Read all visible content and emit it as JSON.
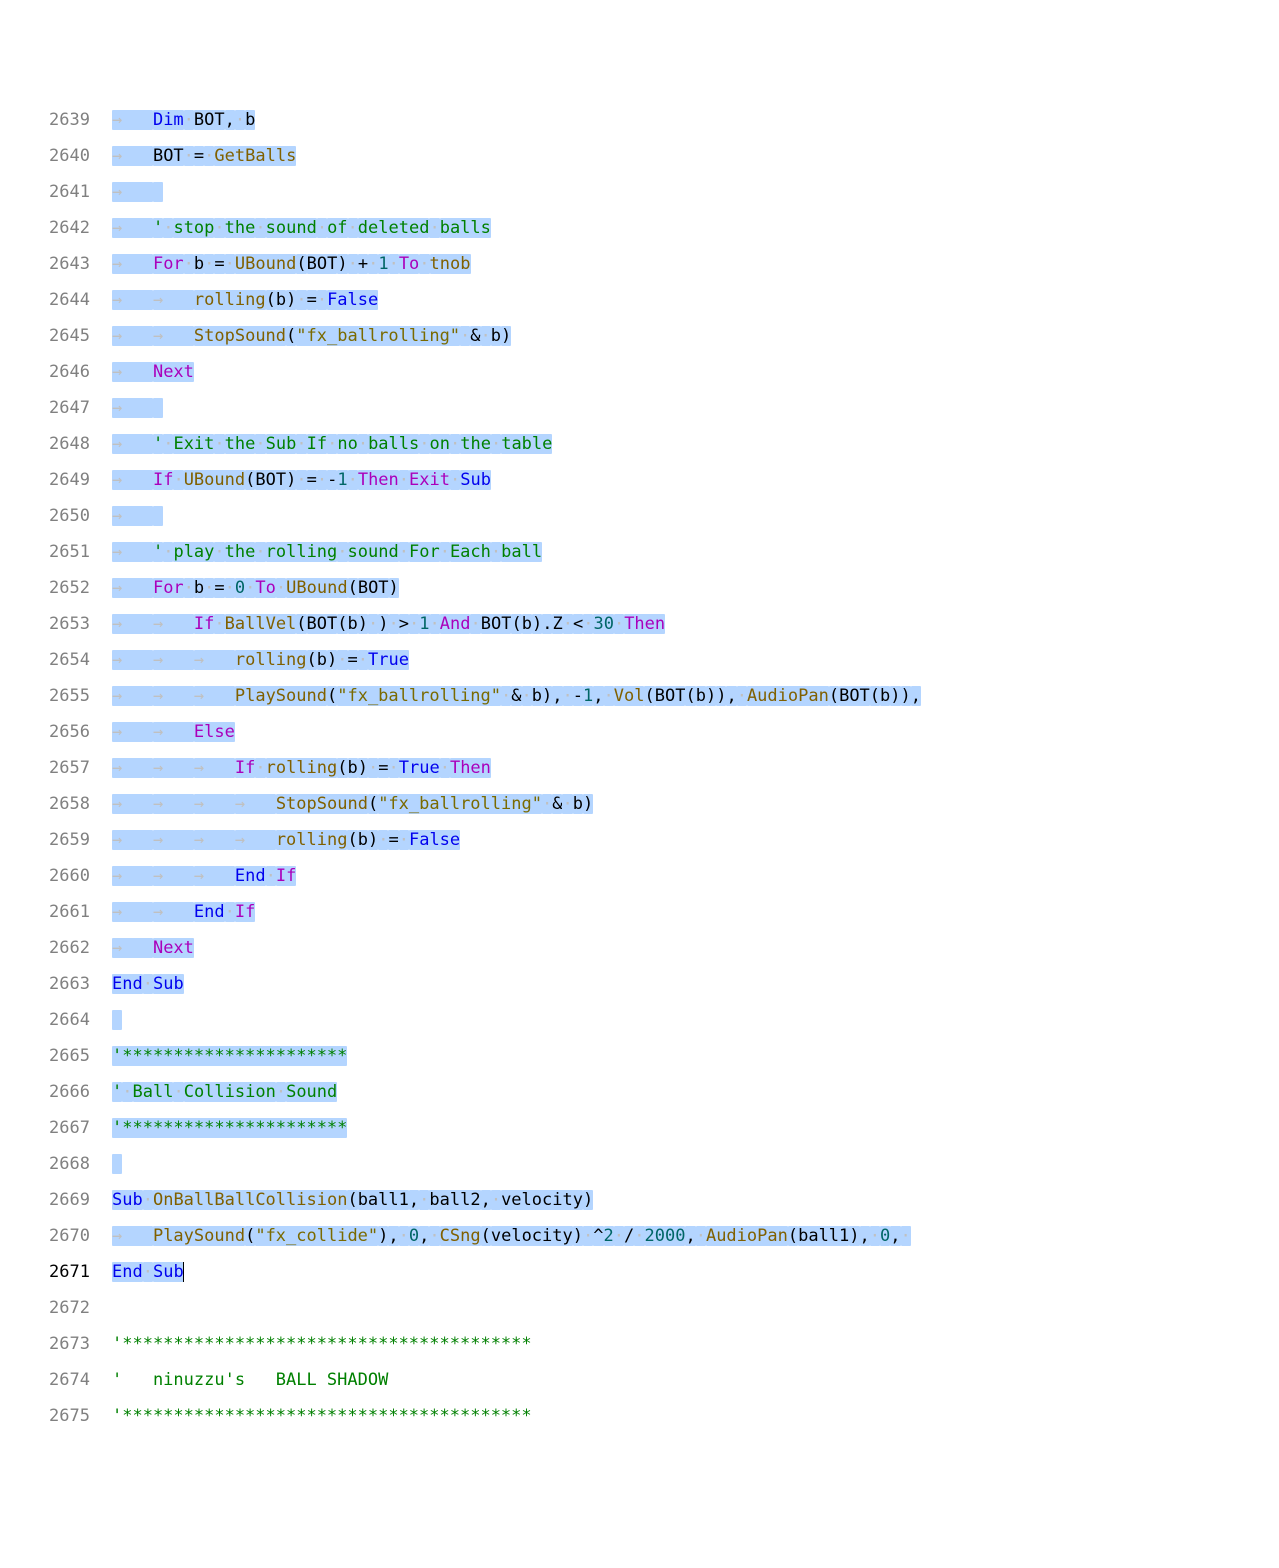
{
  "startLine": 2639,
  "currentLine": 2671,
  "selection": {
    "fromLine": 2639,
    "toLine": 2671
  },
  "ws": {
    "tab": "→",
    "dot": "·"
  },
  "lines": [
    {
      "n": 2639,
      "indent": 1,
      "sel": true,
      "tokens": [
        [
          "kw2",
          "Dim"
        ],
        [
          "ws",
          "·"
        ],
        [
          "pn",
          "BOT"
        ],
        [
          "pn",
          ","
        ],
        [
          "ws",
          "·"
        ],
        [
          "pn",
          "b"
        ]
      ]
    },
    {
      "n": 2640,
      "indent": 1,
      "sel": true,
      "tokens": [
        [
          "pn",
          "BOT"
        ],
        [
          "ws",
          "·"
        ],
        [
          "op",
          "="
        ],
        [
          "ws",
          "·"
        ],
        [
          "id",
          "GetBalls"
        ]
      ]
    },
    {
      "n": 2641,
      "indent": 1,
      "sel": true,
      "tokens": []
    },
    {
      "n": 2642,
      "indent": 1,
      "sel": true,
      "tokens": [
        [
          "com",
          "'"
        ],
        [
          "ws",
          "·"
        ],
        [
          "com",
          "stop"
        ],
        [
          "ws",
          "·"
        ],
        [
          "com",
          "the"
        ],
        [
          "ws",
          "·"
        ],
        [
          "com",
          "sound"
        ],
        [
          "ws",
          "·"
        ],
        [
          "com",
          "of"
        ],
        [
          "ws",
          "·"
        ],
        [
          "com",
          "deleted"
        ],
        [
          "ws",
          "·"
        ],
        [
          "com",
          "balls"
        ]
      ]
    },
    {
      "n": 2643,
      "indent": 1,
      "sel": true,
      "tokens": [
        [
          "kw",
          "For"
        ],
        [
          "ws",
          "·"
        ],
        [
          "pn",
          "b"
        ],
        [
          "ws",
          "·"
        ],
        [
          "op",
          "="
        ],
        [
          "ws",
          "·"
        ],
        [
          "id",
          "UBound"
        ],
        [
          "pn",
          "("
        ],
        [
          "pn",
          "BOT"
        ],
        [
          "pn",
          ")"
        ],
        [
          "ws",
          "·"
        ],
        [
          "op",
          "+"
        ],
        [
          "ws",
          "·"
        ],
        [
          "num",
          "1"
        ],
        [
          "ws",
          "·"
        ],
        [
          "kw",
          "To"
        ],
        [
          "ws",
          "·"
        ],
        [
          "id",
          "tnob"
        ]
      ]
    },
    {
      "n": 2644,
      "indent": 2,
      "sel": true,
      "tokens": [
        [
          "id",
          "rolling"
        ],
        [
          "pn",
          "("
        ],
        [
          "pn",
          "b"
        ],
        [
          "pn",
          ")"
        ],
        [
          "ws",
          "·"
        ],
        [
          "op",
          "="
        ],
        [
          "ws",
          "·"
        ],
        [
          "kw2",
          "False"
        ]
      ]
    },
    {
      "n": 2645,
      "indent": 2,
      "sel": true,
      "tokens": [
        [
          "id",
          "StopSound"
        ],
        [
          "pn",
          "("
        ],
        [
          "str",
          "\"fx_ballrolling\""
        ],
        [
          "ws",
          "·"
        ],
        [
          "op",
          "&"
        ],
        [
          "ws",
          "·"
        ],
        [
          "pn",
          "b"
        ],
        [
          "pn",
          ")"
        ]
      ]
    },
    {
      "n": 2646,
      "indent": 1,
      "sel": true,
      "tokens": [
        [
          "kw",
          "Next"
        ]
      ]
    },
    {
      "n": 2647,
      "indent": 1,
      "sel": true,
      "tokens": []
    },
    {
      "n": 2648,
      "indent": 1,
      "sel": true,
      "tokens": [
        [
          "com",
          "'"
        ],
        [
          "ws",
          "·"
        ],
        [
          "com",
          "Exit"
        ],
        [
          "ws",
          "·"
        ],
        [
          "com",
          "the"
        ],
        [
          "ws",
          "·"
        ],
        [
          "com",
          "Sub"
        ],
        [
          "ws",
          "·"
        ],
        [
          "com",
          "If"
        ],
        [
          "ws",
          "·"
        ],
        [
          "com",
          "no"
        ],
        [
          "ws",
          "·"
        ],
        [
          "com",
          "balls"
        ],
        [
          "ws",
          "·"
        ],
        [
          "com",
          "on"
        ],
        [
          "ws",
          "·"
        ],
        [
          "com",
          "the"
        ],
        [
          "ws",
          "·"
        ],
        [
          "com",
          "table"
        ]
      ]
    },
    {
      "n": 2649,
      "indent": 1,
      "sel": true,
      "tokens": [
        [
          "kw",
          "If"
        ],
        [
          "ws",
          "·"
        ],
        [
          "id",
          "UBound"
        ],
        [
          "pn",
          "("
        ],
        [
          "pn",
          "BOT"
        ],
        [
          "pn",
          ")"
        ],
        [
          "ws",
          "·"
        ],
        [
          "op",
          "="
        ],
        [
          "ws",
          "·"
        ],
        [
          "op",
          "-"
        ],
        [
          "num",
          "1"
        ],
        [
          "ws",
          "·"
        ],
        [
          "kw",
          "Then"
        ],
        [
          "ws",
          "·"
        ],
        [
          "kw",
          "Exit"
        ],
        [
          "ws",
          "·"
        ],
        [
          "kw2",
          "Sub"
        ]
      ]
    },
    {
      "n": 2650,
      "indent": 1,
      "sel": true,
      "tokens": []
    },
    {
      "n": 2651,
      "indent": 1,
      "sel": true,
      "tokens": [
        [
          "com",
          "'"
        ],
        [
          "ws",
          "·"
        ],
        [
          "com",
          "play"
        ],
        [
          "ws",
          "·"
        ],
        [
          "com",
          "the"
        ],
        [
          "ws",
          "·"
        ],
        [
          "com",
          "rolling"
        ],
        [
          "ws",
          "·"
        ],
        [
          "com",
          "sound"
        ],
        [
          "ws",
          "·"
        ],
        [
          "com",
          "For"
        ],
        [
          "ws",
          "·"
        ],
        [
          "com",
          "Each"
        ],
        [
          "ws",
          "·"
        ],
        [
          "com",
          "ball"
        ]
      ]
    },
    {
      "n": 2652,
      "indent": 1,
      "sel": true,
      "tokens": [
        [
          "kw",
          "For"
        ],
        [
          "ws",
          "·"
        ],
        [
          "pn",
          "b"
        ],
        [
          "ws",
          "·"
        ],
        [
          "op",
          "="
        ],
        [
          "ws",
          "·"
        ],
        [
          "num",
          "0"
        ],
        [
          "ws",
          "·"
        ],
        [
          "kw",
          "To"
        ],
        [
          "ws",
          "·"
        ],
        [
          "id",
          "UBound"
        ],
        [
          "pn",
          "("
        ],
        [
          "pn",
          "BOT"
        ],
        [
          "pn",
          ")"
        ]
      ]
    },
    {
      "n": 2653,
      "indent": 2,
      "sel": true,
      "tokens": [
        [
          "kw",
          "If"
        ],
        [
          "ws",
          "·"
        ],
        [
          "id",
          "BallVel"
        ],
        [
          "pn",
          "("
        ],
        [
          "pn",
          "BOT"
        ],
        [
          "pn",
          "("
        ],
        [
          "pn",
          "b"
        ],
        [
          "pn",
          ")"
        ],
        [
          "ws",
          "·"
        ],
        [
          "pn",
          ")"
        ],
        [
          "ws",
          "·"
        ],
        [
          "op",
          ">"
        ],
        [
          "ws",
          "·"
        ],
        [
          "num",
          "1"
        ],
        [
          "ws",
          "·"
        ],
        [
          "kw",
          "And"
        ],
        [
          "ws",
          "·"
        ],
        [
          "pn",
          "BOT"
        ],
        [
          "pn",
          "("
        ],
        [
          "pn",
          "b"
        ],
        [
          "pn",
          ")"
        ],
        [
          "pn",
          "."
        ],
        [
          "pn",
          "Z"
        ],
        [
          "ws",
          "·"
        ],
        [
          "op",
          "<"
        ],
        [
          "ws",
          "·"
        ],
        [
          "num",
          "30"
        ],
        [
          "ws",
          "·"
        ],
        [
          "kw",
          "Then"
        ]
      ]
    },
    {
      "n": 2654,
      "indent": 3,
      "sel": true,
      "tokens": [
        [
          "id",
          "rolling"
        ],
        [
          "pn",
          "("
        ],
        [
          "pn",
          "b"
        ],
        [
          "pn",
          ")"
        ],
        [
          "ws",
          "·"
        ],
        [
          "op",
          "="
        ],
        [
          "ws",
          "·"
        ],
        [
          "kw2",
          "True"
        ]
      ]
    },
    {
      "n": 2655,
      "indent": 3,
      "sel": true,
      "tokens": [
        [
          "id",
          "PlaySound"
        ],
        [
          "pn",
          "("
        ],
        [
          "str",
          "\"fx_ballrolling\""
        ],
        [
          "ws",
          "·"
        ],
        [
          "op",
          "&"
        ],
        [
          "ws",
          "·"
        ],
        [
          "pn",
          "b"
        ],
        [
          "pn",
          ")"
        ],
        [
          "pn",
          ","
        ],
        [
          "ws",
          "·"
        ],
        [
          "op",
          "-"
        ],
        [
          "num",
          "1"
        ],
        [
          "pn",
          ","
        ],
        [
          "ws",
          "·"
        ],
        [
          "id",
          "Vol"
        ],
        [
          "pn",
          "("
        ],
        [
          "pn",
          "BOT"
        ],
        [
          "pn",
          "("
        ],
        [
          "pn",
          "b"
        ],
        [
          "pn",
          ")"
        ],
        [
          "pn",
          ")"
        ],
        [
          "pn",
          ","
        ],
        [
          "ws",
          "·"
        ],
        [
          "id",
          "AudioPan"
        ],
        [
          "pn",
          "("
        ],
        [
          "pn",
          "BOT"
        ],
        [
          "pn",
          "("
        ],
        [
          "pn",
          "b"
        ],
        [
          "pn",
          ")"
        ],
        [
          "pn",
          ")"
        ],
        [
          "pn",
          ","
        ]
      ]
    },
    {
      "n": 2656,
      "indent": 2,
      "sel": true,
      "tokens": [
        [
          "kw",
          "Else"
        ]
      ]
    },
    {
      "n": 2657,
      "indent": 3,
      "sel": true,
      "tokens": [
        [
          "kw",
          "If"
        ],
        [
          "ws",
          "·"
        ],
        [
          "id",
          "rolling"
        ],
        [
          "pn",
          "("
        ],
        [
          "pn",
          "b"
        ],
        [
          "pn",
          ")"
        ],
        [
          "ws",
          "·"
        ],
        [
          "op",
          "="
        ],
        [
          "ws",
          "·"
        ],
        [
          "kw2",
          "True"
        ],
        [
          "ws",
          "·"
        ],
        [
          "kw",
          "Then"
        ]
      ]
    },
    {
      "n": 2658,
      "indent": 4,
      "sel": true,
      "tokens": [
        [
          "id",
          "StopSound"
        ],
        [
          "pn",
          "("
        ],
        [
          "str",
          "\"fx_ballrolling\""
        ],
        [
          "ws",
          "·"
        ],
        [
          "op",
          "&"
        ],
        [
          "ws",
          "·"
        ],
        [
          "pn",
          "b"
        ],
        [
          "pn",
          ")"
        ]
      ]
    },
    {
      "n": 2659,
      "indent": 4,
      "sel": true,
      "tokens": [
        [
          "id",
          "rolling"
        ],
        [
          "pn",
          "("
        ],
        [
          "pn",
          "b"
        ],
        [
          "pn",
          ")"
        ],
        [
          "ws",
          "·"
        ],
        [
          "op",
          "="
        ],
        [
          "ws",
          "·"
        ],
        [
          "kw2",
          "False"
        ]
      ]
    },
    {
      "n": 2660,
      "indent": 3,
      "sel": true,
      "tokens": [
        [
          "kw2",
          "End"
        ],
        [
          "ws",
          "·"
        ],
        [
          "kw",
          "If"
        ]
      ]
    },
    {
      "n": 2661,
      "indent": 2,
      "sel": true,
      "tokens": [
        [
          "kw2",
          "End"
        ],
        [
          "ws",
          "·"
        ],
        [
          "kw",
          "If"
        ]
      ]
    },
    {
      "n": 2662,
      "indent": 1,
      "sel": true,
      "tokens": [
        [
          "kw",
          "Next"
        ]
      ]
    },
    {
      "n": 2663,
      "indent": 0,
      "sel": true,
      "tokens": [
        [
          "kw2",
          "End"
        ],
        [
          "ws",
          "·"
        ],
        [
          "kw2",
          "Sub"
        ]
      ]
    },
    {
      "n": 2664,
      "indent": 0,
      "sel": true,
      "tokens": []
    },
    {
      "n": 2665,
      "indent": 0,
      "sel": true,
      "tokens": [
        [
          "com",
          "'**********************"
        ]
      ]
    },
    {
      "n": 2666,
      "indent": 0,
      "sel": true,
      "tokens": [
        [
          "com",
          "'"
        ],
        [
          "ws",
          "·"
        ],
        [
          "com",
          "Ball"
        ],
        [
          "ws",
          "·"
        ],
        [
          "com",
          "Collision"
        ],
        [
          "ws",
          "·"
        ],
        [
          "com",
          "Sound"
        ]
      ]
    },
    {
      "n": 2667,
      "indent": 0,
      "sel": true,
      "tokens": [
        [
          "com",
          "'**********************"
        ]
      ]
    },
    {
      "n": 2668,
      "indent": 0,
      "sel": true,
      "tokens": []
    },
    {
      "n": 2669,
      "indent": 0,
      "sel": true,
      "tokens": [
        [
          "kw2",
          "Sub"
        ],
        [
          "ws",
          "·"
        ],
        [
          "id",
          "OnBallBallCollision"
        ],
        [
          "pn",
          "("
        ],
        [
          "pn",
          "ball1"
        ],
        [
          "pn",
          ","
        ],
        [
          "ws",
          "·"
        ],
        [
          "pn",
          "ball2"
        ],
        [
          "pn",
          ","
        ],
        [
          "ws",
          "·"
        ],
        [
          "pn",
          "velocity"
        ],
        [
          "pn",
          ")"
        ]
      ]
    },
    {
      "n": 2670,
      "indent": 1,
      "sel": true,
      "tokens": [
        [
          "id",
          "PlaySound"
        ],
        [
          "pn",
          "("
        ],
        [
          "str",
          "\"fx_collide\""
        ],
        [
          "pn",
          ")"
        ],
        [
          "pn",
          ","
        ],
        [
          "ws",
          "·"
        ],
        [
          "num",
          "0"
        ],
        [
          "pn",
          ","
        ],
        [
          "ws",
          "·"
        ],
        [
          "id",
          "CSng"
        ],
        [
          "pn",
          "("
        ],
        [
          "pn",
          "velocity"
        ],
        [
          "pn",
          ")"
        ],
        [
          "ws",
          "·"
        ],
        [
          "op",
          "^"
        ],
        [
          "num",
          "2"
        ],
        [
          "ws",
          "·"
        ],
        [
          "op",
          "/"
        ],
        [
          "ws",
          "·"
        ],
        [
          "num",
          "2000"
        ],
        [
          "pn",
          ","
        ],
        [
          "ws",
          "·"
        ],
        [
          "id",
          "AudioPan"
        ],
        [
          "pn",
          "("
        ],
        [
          "pn",
          "ball1"
        ],
        [
          "pn",
          ")"
        ],
        [
          "pn",
          ","
        ],
        [
          "ws",
          "·"
        ],
        [
          "num",
          "0"
        ],
        [
          "pn",
          ","
        ],
        [
          "ws",
          "·"
        ]
      ]
    },
    {
      "n": 2671,
      "indent": 0,
      "sel": true,
      "cursor": true,
      "tokens": [
        [
          "kw2",
          "End"
        ],
        [
          "ws",
          "·"
        ],
        [
          "kw2",
          "Sub"
        ]
      ]
    },
    {
      "n": 2672,
      "indent": 0,
      "sel": false,
      "tokens": []
    },
    {
      "n": 2673,
      "indent": 0,
      "sel": false,
      "tokens": [
        [
          "com",
          "'****************************************"
        ]
      ]
    },
    {
      "n": 2674,
      "indent": 0,
      "sel": false,
      "tokens": [
        [
          "com",
          "'   ninuzzu's   BALL SHADOW"
        ]
      ]
    },
    {
      "n": 2675,
      "indent": 0,
      "sel": false,
      "tokens": [
        [
          "com",
          "'****************************************"
        ]
      ]
    }
  ]
}
